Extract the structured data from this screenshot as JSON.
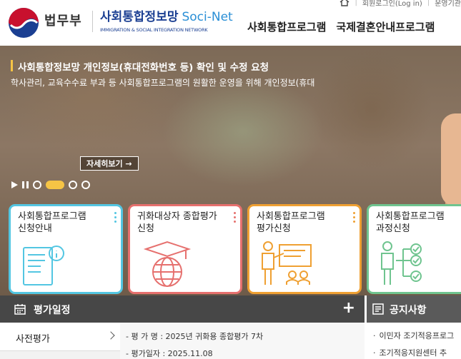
{
  "toplinks": {
    "login": "회원로그인(Log in)",
    "cut": "운영기관"
  },
  "header": {
    "ministry": "법무부",
    "site_name": "사회통합정보망",
    "site_name_en": "Soci-Net",
    "site_sub": "IMMIGRATION & SOCIAL INTEGRATION NETWORK"
  },
  "gnb": [
    "사회통합프로그램",
    "국제결혼안내프로그램"
  ],
  "hero": {
    "title": "사회통합정보망 개인정보(휴대전화번호 등) 확인 및 수정 요청",
    "desc": "학사관리, 교육수수료 부과 등 사회통합프로그램의 원활한 운영을 위해 개인정보(휴대",
    "more": "자세히보기 →",
    "active_slide": 2,
    "slide_count": 4
  },
  "cards": [
    {
      "line1": "사회통합프로그램",
      "line2": "신청안내",
      "color": "#53c6e2",
      "icon": "document-info-icon"
    },
    {
      "line1": "귀화대상자 종합평가",
      "line2": "신청",
      "color": "#e6706e",
      "icon": "graduation-globe-icon"
    },
    {
      "line1": "사회통합프로그램",
      "line2": "평가신청",
      "color": "#efa032",
      "icon": "presentation-icon"
    },
    {
      "line1": "사회통합프로그램",
      "line2": "과정신청",
      "color": "#6fc48f",
      "icon": "process-flow-icon"
    }
  ],
  "schedule": {
    "title": "평가일정",
    "plus": "+",
    "tab": "사전평가",
    "rows": [
      "- 평 가 명 : 2025년 귀화용 종합평가 7차",
      "- 평가일자 : 2025.11.08"
    ]
  },
  "notice": {
    "title": "공지사항",
    "rows": [
      "이민자 조기적응프로그",
      "조기적응지원센터 추"
    ]
  }
}
